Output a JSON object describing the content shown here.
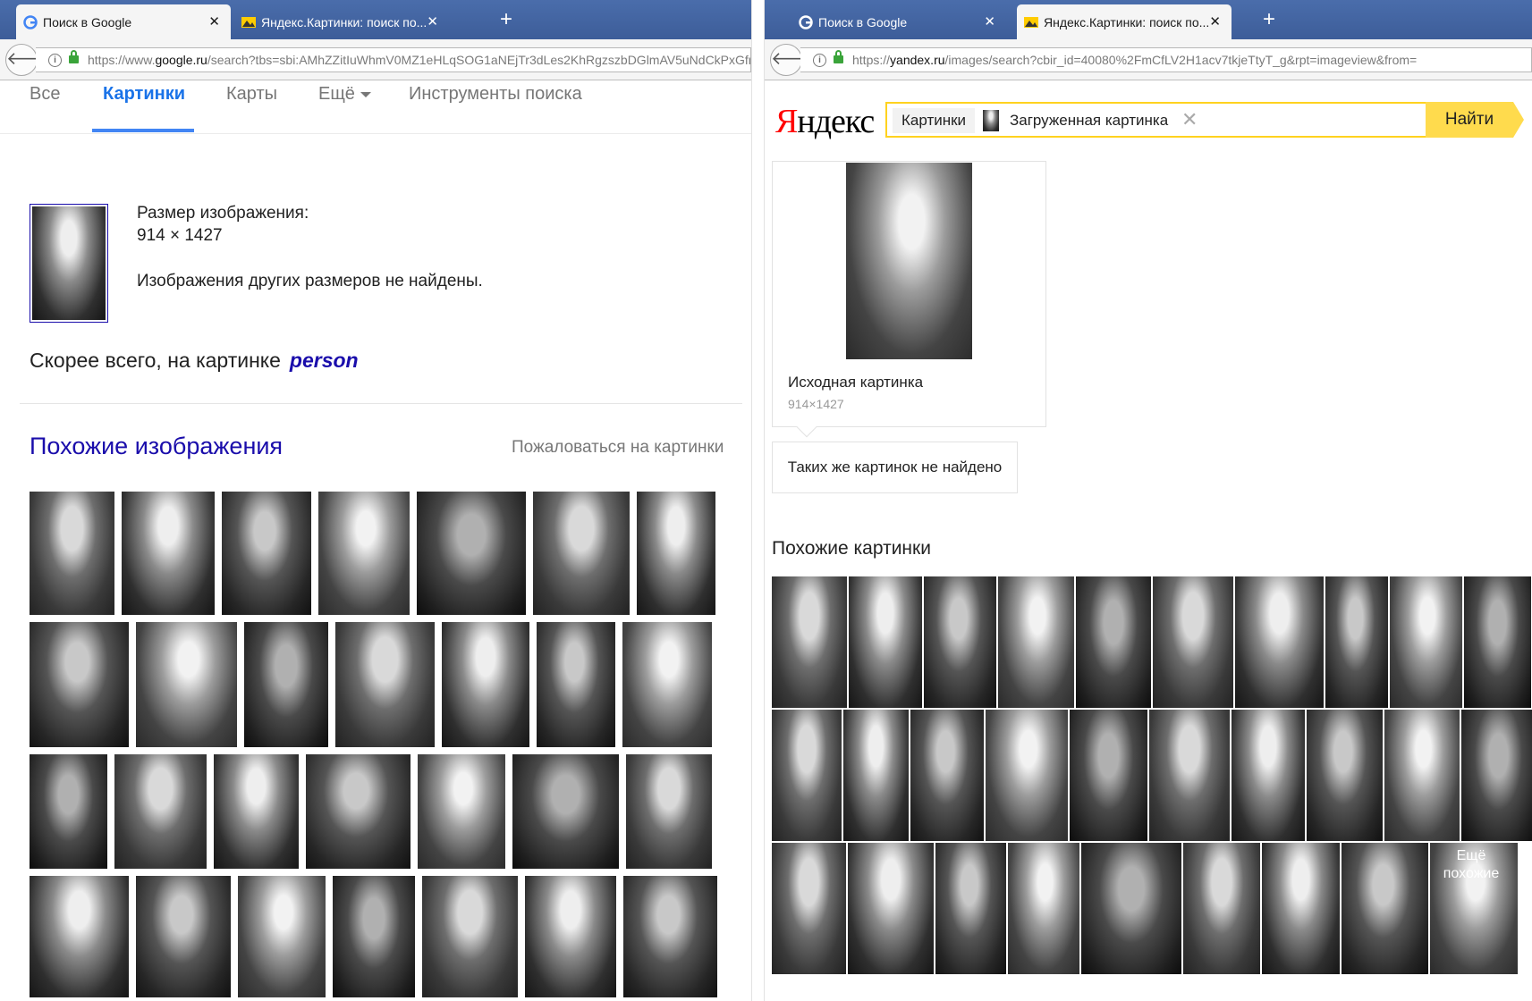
{
  "left_browser": {
    "tabs": [
      {
        "label": "Поиск в Google",
        "active": true
      },
      {
        "label": "Яндекс.Картинки: поиск по...",
        "active": false
      }
    ],
    "url_prefix": "https://www.",
    "url_domain": "google.ru",
    "url_path": "/search?tbs=sbi:AMhZZitIuWhmV0MZ1eHLqSOG1aNEjTr3dLes2KhRgzszbDGlmAV5uNdCkPxGfm"
  },
  "google": {
    "nav": {
      "all": "Все",
      "images": "Картинки",
      "maps": "Карты",
      "more": "Ещё",
      "tools": "Инструменты поиска"
    },
    "size_label": "Размер изображения:",
    "size_value": "914 × 1427",
    "no_other_sizes": "Изображения других размеров не найдены.",
    "likely_prefix": "Скорее всего, на картинке",
    "likely_value": "person",
    "similar_title": "Похожие изображения",
    "report_link": "Пожаловаться на картинки"
  },
  "right_browser": {
    "tabs": [
      {
        "label": "Поиск в Google",
        "active": false
      },
      {
        "label": "Яндекс.Картинки: поиск по...",
        "active": true
      }
    ],
    "url_prefix": "https://",
    "url_domain": "yandex.ru",
    "url_path": "/images/search?cbir_id=40080%2FmCfLV2H1acv7tkjeTtyT_g&rpt=imageview&from="
  },
  "yandex": {
    "logo_first": "Я",
    "logo_rest": "ндекс",
    "search_chip": "Картинки",
    "uploaded_label": "Загруженная картинка",
    "find_button": "Найти",
    "source_title": "Исходная картинка",
    "source_size": "914×1427",
    "not_found": "Таких же картинок не найдено",
    "similar_title": "Похожие картинки",
    "more_similar_line1": "Ещё",
    "more_similar_line2": "похожие"
  }
}
